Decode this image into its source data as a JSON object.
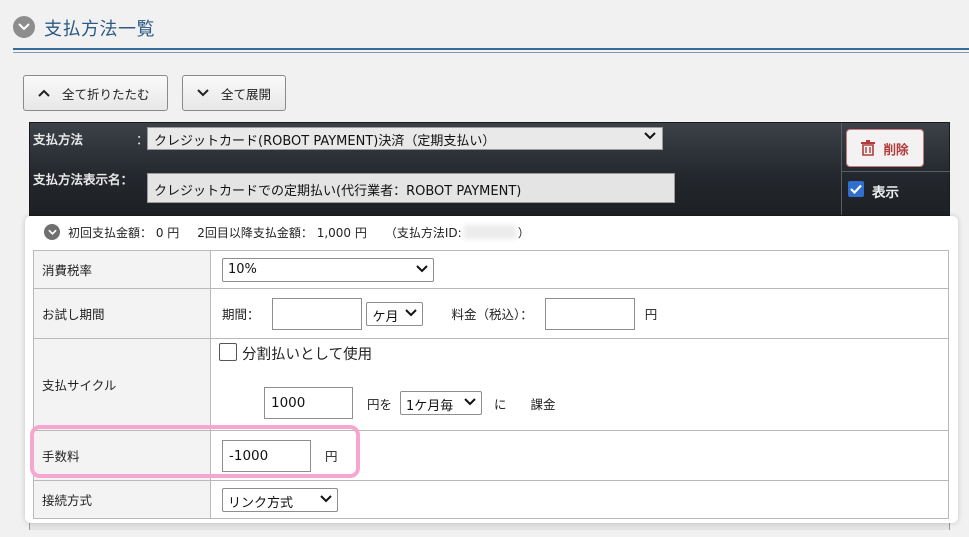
{
  "header": {
    "title": "支払方法一覧"
  },
  "toolbar": {
    "collapse_all": "全て折りたたむ",
    "expand_all": "全て展開"
  },
  "method": {
    "label": "支払方法",
    "colon": "：",
    "selected": "クレジットカード(ROBOT PAYMENT)決済（定期支払い）",
    "display_name_label": "支払方法表示名：",
    "display_name_value": "クレジットカードでの定期払い(代行業者：ROBOT PAYMENT)",
    "delete_label": "削除",
    "show_label": "表示"
  },
  "summary": {
    "first_payment": "初回支払金額： 0 円",
    "second_payment": "2回目以降支払金額： 1,000 円",
    "id_prefix": "（支払方法ID:",
    "id_suffix": "）"
  },
  "rows": {
    "tax": {
      "label": "消費税率",
      "value": "10%"
    },
    "trial": {
      "label": "お試し期間",
      "period_label": "期間：",
      "period_value": "",
      "unit": "ケ月",
      "fee_label": "料金（税込）：",
      "fee_value": "",
      "currency": "円"
    },
    "cycle": {
      "label": "支払サイクル",
      "installment_label": "分割払いとして使用",
      "amount": "1000",
      "yen_wo": "円を",
      "cycle_value": "1ケ月毎",
      "ni": "に",
      "charge": "課金"
    },
    "fee": {
      "label": "手数料",
      "value": "-1000",
      "currency": "円"
    },
    "connection": {
      "label": "接続方式",
      "value": "リンク方式"
    }
  },
  "colors": {
    "accent": "#2b5a84",
    "delete": "#b23b3b",
    "highlight": "#f6a6cf",
    "checkbox": "#2f6fcf"
  }
}
